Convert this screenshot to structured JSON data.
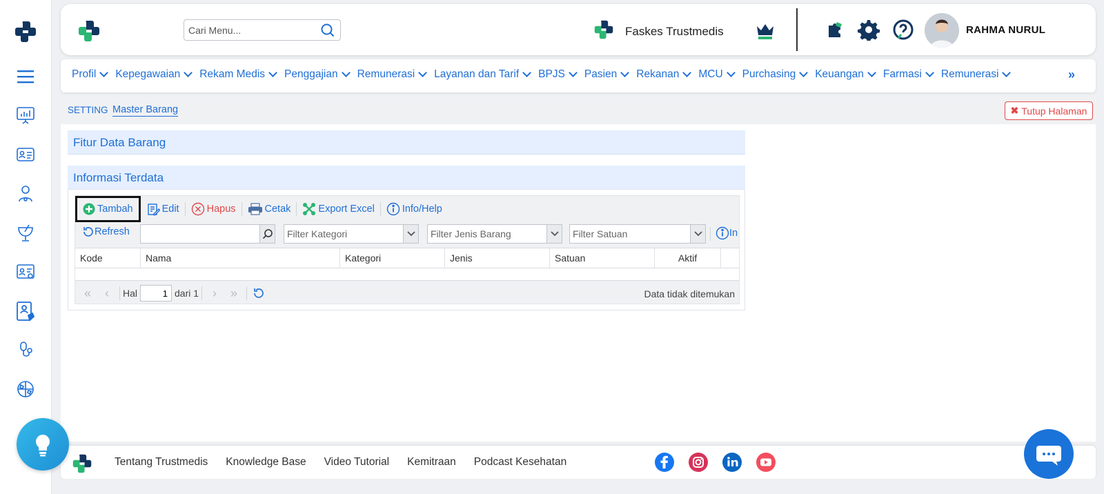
{
  "header": {
    "search_placeholder": "Cari Menu...",
    "faskes_name": "Faskes Trustmedis",
    "user_name": "RAHMA NURUL"
  },
  "menu": {
    "items": [
      "Profil",
      "Kepegawaian",
      "Rekam Medis",
      "Penggajian",
      "Remunerasi",
      "Layanan dan Tarif",
      "BPJS",
      "Pasien",
      "Rekanan",
      "MCU",
      "Purchasing",
      "Keuangan",
      "Farmasi",
      "Remunerasi"
    ],
    "more": "»"
  },
  "breadcrumb": {
    "section": "SETTING",
    "page": "Master Barang",
    "close_label": "Tutup Halaman",
    "close_mark": "✖"
  },
  "panels": {
    "fitur_title": "Fitur Data Barang",
    "info_title": "Informasi Terdata"
  },
  "toolbar": {
    "tambah": "Tambah",
    "edit": "Edit",
    "hapus": "Hapus",
    "cetak": "Cetak",
    "export": "Export Excel",
    "info": "Info/Help",
    "refresh": "Refresh",
    "info_short": "In"
  },
  "filters": {
    "kategori": "Filter Kategori",
    "jenis": "Filter Jenis Barang",
    "satuan": "Filter Satuan"
  },
  "table": {
    "columns": [
      "Kode",
      "Nama",
      "Kategori",
      "Jenis",
      "Satuan",
      "Aktif"
    ],
    "rows": []
  },
  "pager": {
    "hal_label": "Hal",
    "page": "1",
    "of_label": "dari 1",
    "status": "Data tidak ditemukan"
  },
  "footer": {
    "links": [
      "Tentang Trustmedis",
      "Knowledge Base",
      "Video Tutorial",
      "Kemitraan",
      "Podcast Kesehatan"
    ]
  },
  "colors": {
    "accent": "#1f6fd6",
    "brand_dark": "#13365f",
    "brand_green": "#2bb673",
    "danger": "#e04848"
  }
}
